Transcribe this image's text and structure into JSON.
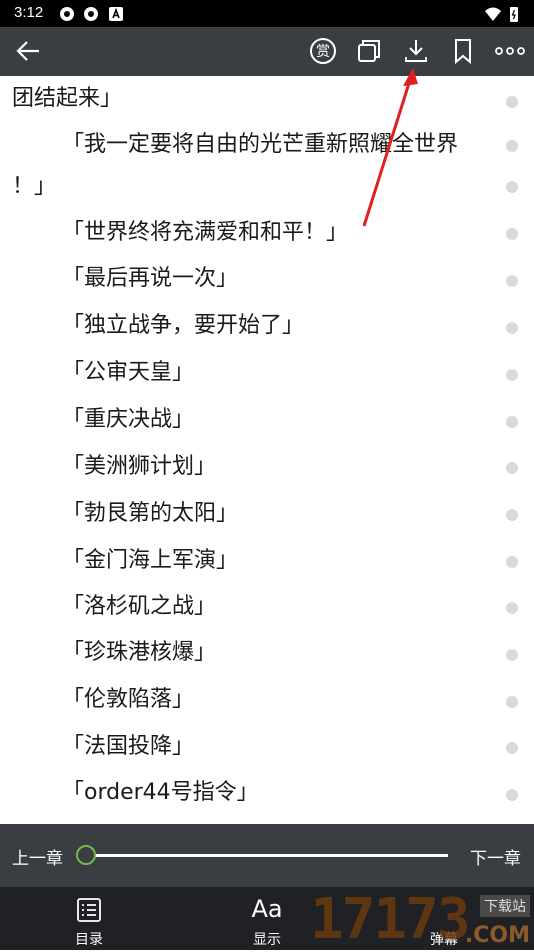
{
  "status_bar": {
    "time": "3:12"
  },
  "toolbar": {
    "back_icon": "arrow-left-icon",
    "reward_label": "赏",
    "icons": [
      "reward-icon",
      "copy-icon",
      "download-icon",
      "bookmark-icon",
      "more-icon"
    ]
  },
  "content": {
    "lines": [
      "团结起来」",
      "「我一定要将自由的光芒重新照耀全世界",
      "！」",
      "「世界终将充满爱和和平！」",
      "「最后再说一次」",
      "「独立战争，要开始了」",
      "「公审天皇」",
      "「重庆决战」",
      "「美洲狮计划」",
      "「勃艮第的太阳」",
      "「金门海上军演」",
      "「洛杉矶之战」",
      "「珍珠港核爆」",
      "「伦敦陷落」",
      "「法国投降」",
      "「order44号指令」"
    ]
  },
  "chapter_nav": {
    "prev": "上一章",
    "next": "下一章",
    "progress": 0.0
  },
  "bottom_nav": {
    "toc": "目录",
    "display": "显示",
    "display_icon_text": "Aa",
    "danmaku": "弹幕"
  },
  "watermark": {
    "number": "17173",
    "site": ".COM",
    "tag": "下载站"
  },
  "colors": {
    "toolbar": "#3a3d42",
    "bottom": "#1f2124",
    "accent": "#7ab648",
    "annotation": "#e02020"
  }
}
